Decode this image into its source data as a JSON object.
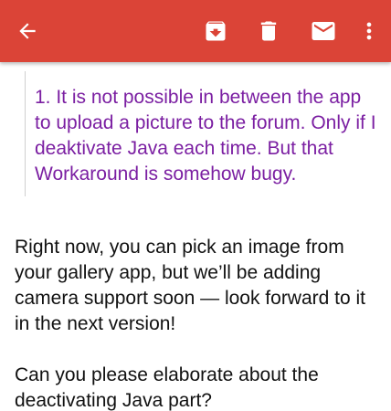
{
  "appbar": {
    "color": "#db4437",
    "icons": [
      "arrow-left-icon",
      "archive-icon",
      "trash-icon",
      "mail-icon",
      "more-vertical-icon"
    ]
  },
  "message": {
    "quoted_text": "1. It is not possible in between the app to upload a picture to the forum. Only if I deaktivate Java each time. But that Workaround is somehow bugy.",
    "quote_color": "#7b1fa2",
    "reply_paragraph_1": "Right now, you can pick an image from your gallery app, but we’ll be adding camera support soon — look forward to it in the next version!",
    "reply_paragraph_2": "Can you please elaborate about the deactivating Java part?"
  }
}
